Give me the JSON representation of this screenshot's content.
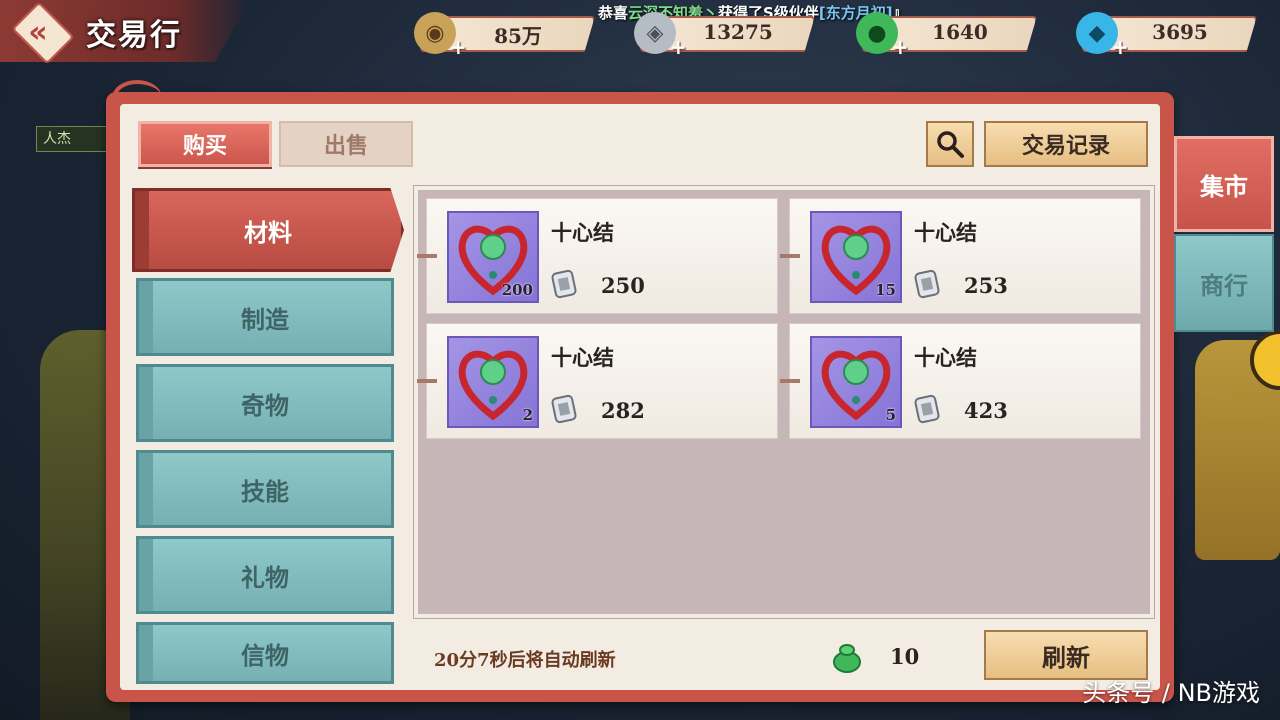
{
  "header": {
    "title": "交易行",
    "announcement": {
      "prefix": "恭喜",
      "player": "云深不知羞丶",
      "middle": "获得了S级伙伴",
      "partner": "[东方月初]",
      "suffix": "』"
    }
  },
  "currencies": [
    {
      "icon": "copper-coin-icon",
      "value": "85万",
      "color": "#c9a25a"
    },
    {
      "icon": "silver-token-icon",
      "value": "13275",
      "color": "#b6bcc4"
    },
    {
      "icon": "jade-pouch-icon",
      "value": "1640",
      "color": "#3fb85a"
    },
    {
      "icon": "blue-gem-icon",
      "value": "3695",
      "color": "#39b6e8"
    }
  ],
  "tabs": {
    "buy": "购买",
    "sell": "出售"
  },
  "toolbar": {
    "search_icon": "search-icon",
    "trade_log": "交易记录"
  },
  "categories": [
    {
      "label": "材料",
      "active": true
    },
    {
      "label": "制造",
      "active": false
    },
    {
      "label": "奇物",
      "active": false
    },
    {
      "label": "技能",
      "active": false
    },
    {
      "label": "礼物",
      "active": false
    },
    {
      "label": "信物",
      "active": false
    }
  ],
  "items": [
    {
      "name": "十心结",
      "qty": "200",
      "price": "250"
    },
    {
      "name": "十心结",
      "qty": "15",
      "price": "253"
    },
    {
      "name": "十心结",
      "qty": "2",
      "price": "282"
    },
    {
      "name": "十心结",
      "qty": "5",
      "price": "423"
    }
  ],
  "footer": {
    "refresh_timer": "20分7秒后将自动刷新",
    "refresh_cost": "10",
    "refresh_button": "刷新"
  },
  "side_tabs": [
    {
      "label": "集市",
      "active": true
    },
    {
      "label": "商行",
      "active": false
    }
  ],
  "background": {
    "name_tag": "人杰",
    "watermark": "头条号 / NB游戏"
  },
  "colors": {
    "accent_red": "#c9544a",
    "teal": "#8ec8c9",
    "gold_button": "#e6bf82",
    "item_bg_purple": "#8574d6"
  }
}
